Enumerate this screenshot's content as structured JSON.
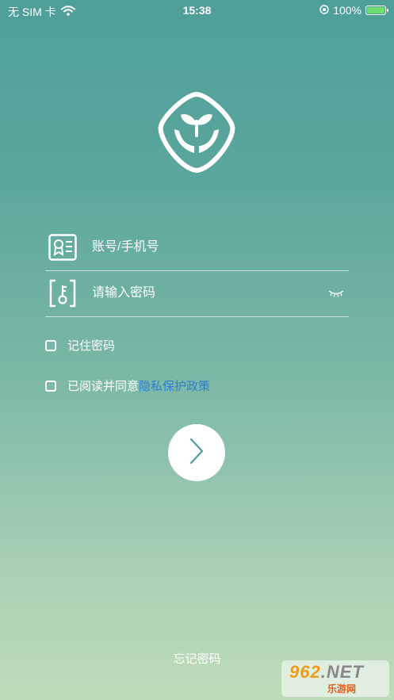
{
  "status_bar": {
    "carrier": "无 SIM 卡",
    "time": "15:38",
    "battery_percent": "100%",
    "battery_level": 1.0,
    "wifi_icon": "wifi-icon",
    "rotation_lock_icon": "rotation-lock-icon"
  },
  "logo": {
    "icon": "hands-sprout-logo-icon"
  },
  "login_form": {
    "account_placeholder": "账号/手机号",
    "account_value": "",
    "password_placeholder": "请输入密码",
    "password_value": "",
    "account_icon": "id-card-icon",
    "password_icon": "key-icon",
    "toggle_visibility_icon": "eye-closed-icon"
  },
  "options": {
    "remember_label": "记住密码",
    "remember_checked": false,
    "agree_label": "已阅读并同意",
    "policy_link": "隐私保护政策",
    "agree_checked": false
  },
  "submit": {
    "icon": "chevron-right-icon"
  },
  "footer": {
    "forgot_password": "忘记密码"
  },
  "watermark": {
    "brand": "962",
    "suffix": ".NET",
    "tagline": "乐游网"
  },
  "colors": {
    "gradient_top": "#4f9f99",
    "gradient_bottom": "#bfdcba",
    "link": "#2f7fd6",
    "arrow": "#4f9f99"
  }
}
